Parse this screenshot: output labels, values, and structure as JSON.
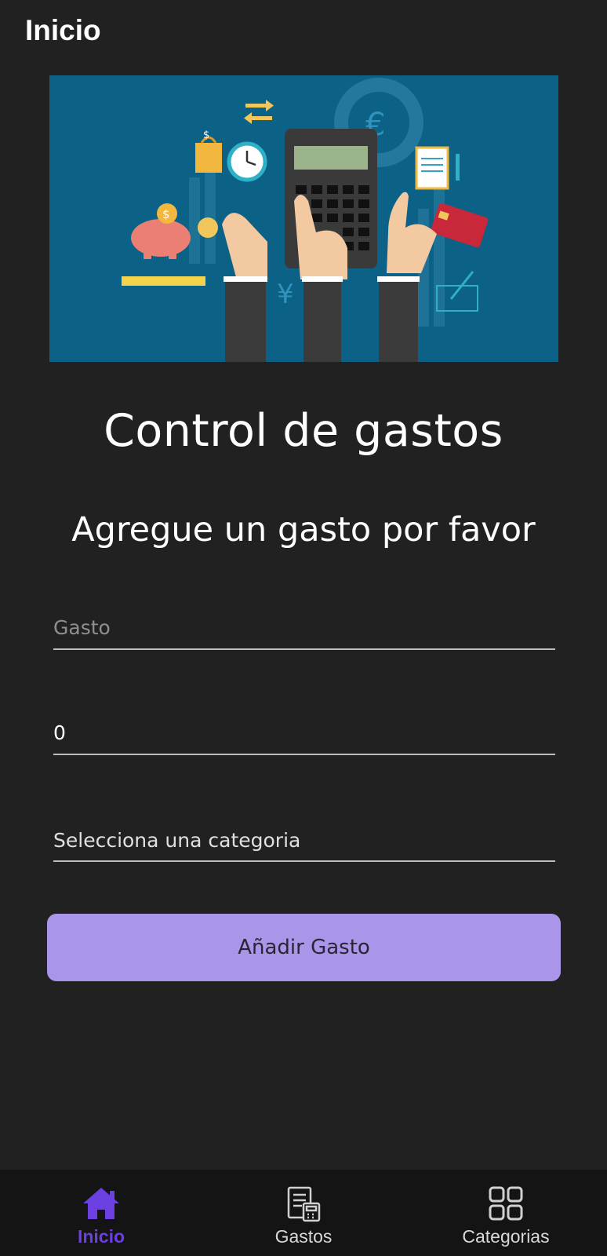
{
  "app_bar": {
    "title": "Inicio"
  },
  "hero_image": {
    "description_icon": "finance-illustration"
  },
  "main": {
    "title": "Control de gastos",
    "subtitle": "Agregue un gasto por favor"
  },
  "form": {
    "expense_placeholder": "Gasto",
    "expense_value": "",
    "amount_value": "0",
    "category_placeholder": "Selecciona una categoria",
    "submit_label": "Añadir Gasto"
  },
  "bottom_nav": {
    "items": [
      {
        "label": "Inicio",
        "icon": "home-icon",
        "active": true
      },
      {
        "label": "Gastos",
        "icon": "receipt-calculator-icon",
        "active": false
      },
      {
        "label": "Categorias",
        "icon": "grid-icon",
        "active": false
      }
    ]
  },
  "colors": {
    "background": "#212121",
    "accent": "#6b3fe0",
    "button": "#a996e8",
    "nav_background": "#141414",
    "hero_background": "#0c6186"
  }
}
